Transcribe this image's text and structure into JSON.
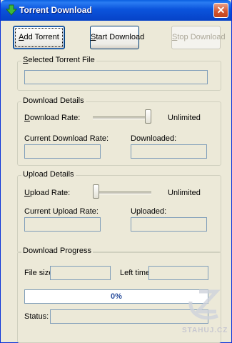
{
  "window": {
    "title": "Torrent Download",
    "close_glyph": "✕"
  },
  "toolbar": {
    "add_torrent": {
      "mnemonic": "A",
      "rest": "dd Torrent"
    },
    "start_download": {
      "mnemonic": "S",
      "rest": "tart Download"
    },
    "stop_download": {
      "mnemonic": "S",
      "rest": "top Download",
      "enabled": false
    }
  },
  "selected_torrent": {
    "legend_mnemonic": "S",
    "legend_rest": "elected Torrent File",
    "value": ""
  },
  "download_details": {
    "legend": "Download Details",
    "rate_mnemonic": "D",
    "rate_rest": "ownload Rate:",
    "rate_value": "Unlimited",
    "rate_slider_level": 1.0,
    "current_rate_label": "Current Download Rate:",
    "downloaded_label": "Downloaded:",
    "current_rate_value": "",
    "downloaded_value": ""
  },
  "upload_details": {
    "legend": "Upload Details",
    "rate_mnemonic": "U",
    "rate_rest": "pload Rate:",
    "rate_value": "Unlimited",
    "rate_slider_level": 0.0,
    "current_rate_label": "Current Upload Rate:",
    "uploaded_label": "Uploaded:",
    "current_rate_value": "",
    "uploaded_value": ""
  },
  "download_progress": {
    "legend": "Download Progress",
    "file_size_label": "File size:",
    "left_time_label": "Left time:",
    "progress_text": "0%",
    "progress_fraction": 0,
    "status_label": "Status:",
    "file_size_value": "",
    "left_time_value": "",
    "status_value": ""
  },
  "watermark": {
    "text": "STAHUJ.CZ"
  },
  "colors": {
    "title_bar": "#0b54dc",
    "window_bg": "#ece9d8",
    "progress_text": "#2b4f9e"
  }
}
